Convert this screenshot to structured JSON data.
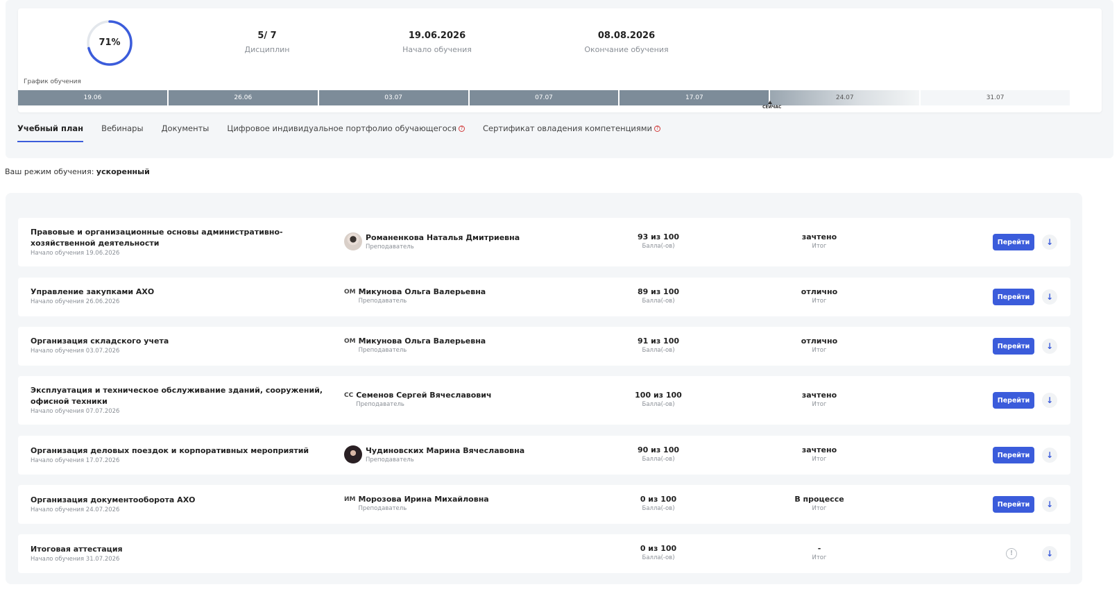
{
  "summary": {
    "progress_text": "71%",
    "progress_fraction": 0.71,
    "disciplines_value": "5/ 7",
    "disciplines_label": "Дисциплин",
    "start_value": "19.06.2026",
    "start_label": "Начало обучения",
    "end_value": "08.08.2026",
    "end_label": "Окончание обучения"
  },
  "schedule": {
    "title": "График обучения",
    "dates": [
      "19.06",
      "26.06",
      "03.07",
      "07.07",
      "17.07",
      "24.07",
      "31.07"
    ],
    "now_label": "СЕЙЧАС"
  },
  "tabs": [
    {
      "label": "Учебный план",
      "active": true
    },
    {
      "label": "Вебинары"
    },
    {
      "label": "Документы"
    },
    {
      "label": "Цифровое индивидуальное портфолио обучающегося",
      "help": "?"
    },
    {
      "label": "Сертификат овладения компетенциями",
      "help": "?"
    }
  ],
  "mode": {
    "prefix": "Ваш режим обучения: ",
    "value": "ускоренный"
  },
  "labels": {
    "teacher_role": "Преподаватель",
    "score_unit": "Балла(-ов)",
    "result_label": "Итог",
    "go_button": "Перейти",
    "arrow": "↓",
    "warn": "!"
  },
  "courses": [
    {
      "name": "Правовые и организационные основы административно-хозяйственной деятельности",
      "start": "Начало обучения 19.06.2026",
      "teacher": "Романенкова Наталья Дмитриевна",
      "avatar": "photo1",
      "score": "93 из 100",
      "result": "зачтено"
    },
    {
      "name": "Управление закупками АХО",
      "start": "Начало обучения 26.06.2026",
      "teacher": "Микунова Ольга Валерьевна",
      "initials": "ОМ",
      "score": "89 из 100",
      "result": "отлично"
    },
    {
      "name": "Организация складского учета",
      "start": "Начало обучения 03.07.2026",
      "teacher": "Микунова Ольга Валерьевна",
      "initials": "ОМ",
      "score": "91 из 100",
      "result": "отлично"
    },
    {
      "name": "Эксплуатация и техническое обслуживание зданий, сооружений, офисной техники",
      "start": "Начало обучения 07.07.2026",
      "teacher": "Семенов Сергей Вячеславович",
      "initials": "СС",
      "score": "100 из 100",
      "result": "зачтено"
    },
    {
      "name": "Организация деловых поездок и корпоративных мероприятий",
      "start": "Начало обучения 17.07.2026",
      "teacher": "Чудиновских Марина Вячеславовна",
      "avatar": "photo2",
      "score": "90 из 100",
      "result": "зачтено"
    },
    {
      "name": "Организация документооборота АХО",
      "start": "Начало обучения 24.07.2026",
      "teacher": "Морозова Ирина Михайловна",
      "initials": "ИМ",
      "score": "0 из 100",
      "result": "В процессе"
    },
    {
      "name": "Итоговая аттестация",
      "start": "Начало обучения 31.07.2026",
      "score": "0 из 100",
      "result": "-",
      "locked": true
    }
  ],
  "colors": {
    "accent": "#3b5cdb",
    "timeline_done": "#7d8c99",
    "muted_text": "#8a8f96"
  }
}
